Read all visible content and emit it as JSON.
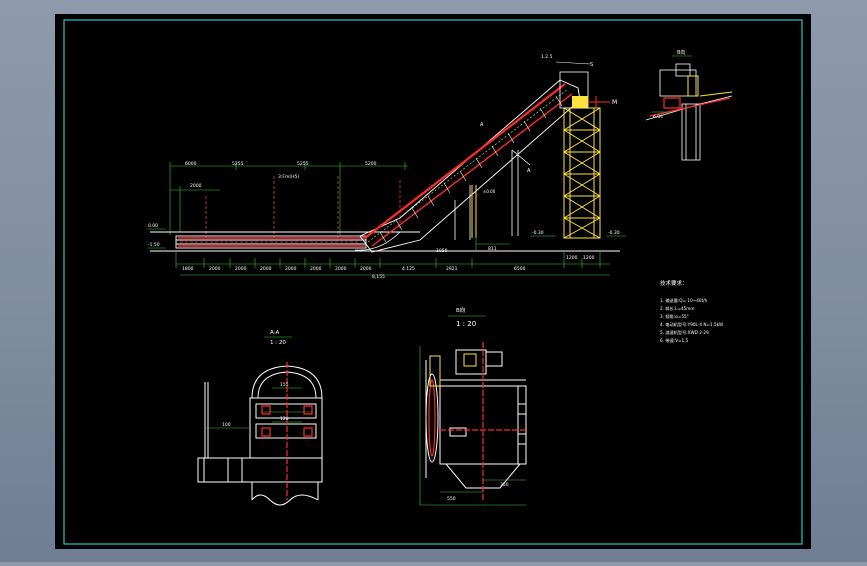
{
  "drawing": {
    "dims_top": [
      "6000",
      "5255",
      "5255",
      "5200"
    ],
    "dims_bottom": [
      "1800",
      "2000",
      "2000",
      "2000",
      "2000",
      "2000",
      "2000",
      "2000",
      "4.125",
      "2921",
      "6500",
      "1200",
      "1200"
    ],
    "dim_total": "8,155",
    "dim_left_vertical": "2000",
    "elev_top": "0.00",
    "elev_bottom": "-1.50",
    "elev_right_1": "-0.30",
    "elev_right_2": "-0.30",
    "note_mid": "3:Fm(H5)",
    "slope_a": "A",
    "slope_b": "A",
    "dim_span": "1050",
    "dim_span2": "811",
    "dim_small": "±0.00",
    "label_s": "S",
    "label_m": "M",
    "top_elev": "1.2.5",
    "head_elev": "6.04",
    "detail_title_right": "B向",
    "section_a_title": "A-A",
    "section_a_scale": "1 : 20",
    "view_b_title": "B向",
    "view_b_scale": "1 : 20",
    "dim_100": "100",
    "dim_155": "155",
    "dim_128": "128",
    "dim_550": "550",
    "dim_350": "350",
    "notes_title": "技术要求：",
    "notes": [
      "1. 输送量:Q= 10~40t/h",
      "2. 斜长:L=45mm",
      "3. 倾角:α=55°",
      "4. 电动机型号:Y90L-4 N=1.5kW",
      "5. 减速机型号:XWD 2-29",
      "6. 带速:V=1.5"
    ]
  }
}
